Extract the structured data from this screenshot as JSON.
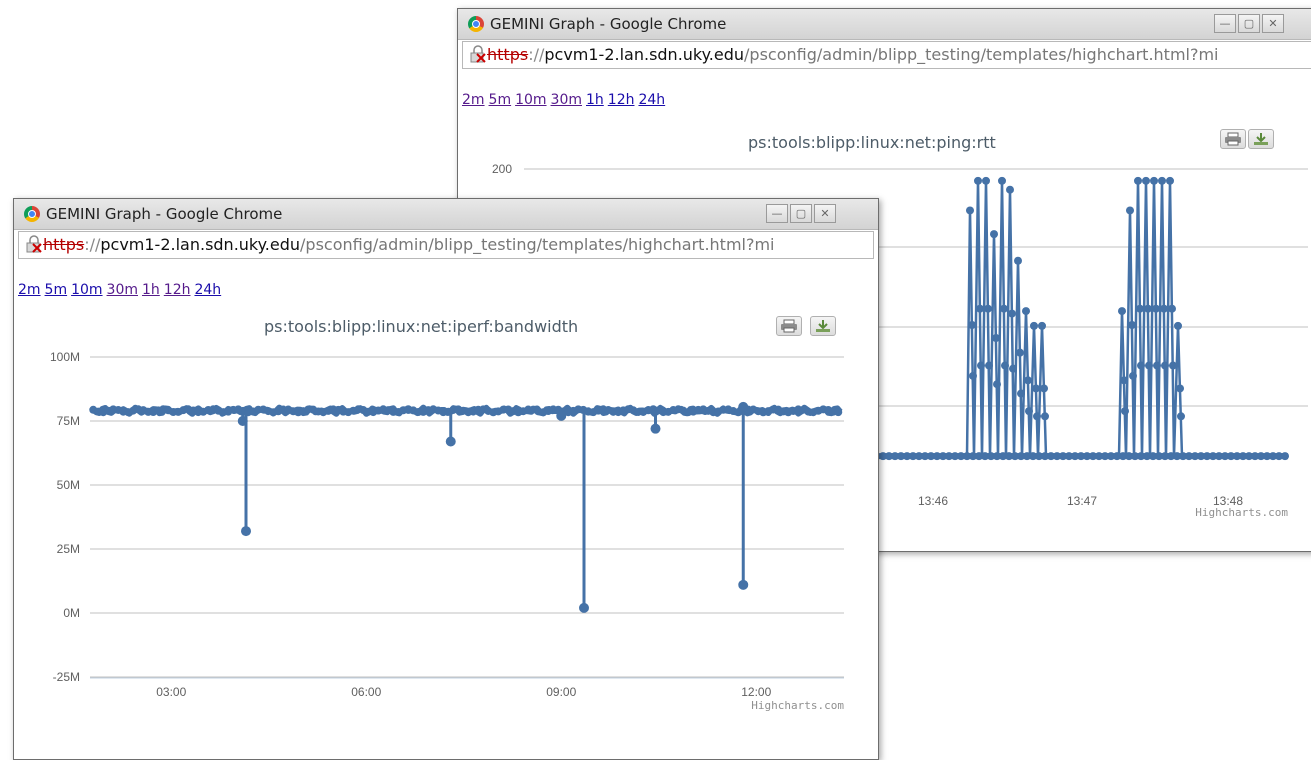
{
  "back_window": {
    "title": "GEMINI Graph - Google Chrome",
    "url": {
      "scheme": "https",
      "sep": "://",
      "host": "pcvm1-2.lan.sdn.uky.edu",
      "path": "/psconfig/admin/blipp_testing/templates/highchart.html?mi"
    },
    "ranges": [
      "2m",
      "5m",
      "10m",
      "30m",
      "1h",
      "12h",
      "24h"
    ],
    "chart_title": "ps:tools:blipp:linux:net:ping:rtt",
    "y_tick_visible": "200",
    "x_ticks": [
      "13:46",
      "13:47",
      "13:48"
    ],
    "credits": "Highcharts.com"
  },
  "front_window": {
    "title": "GEMINI Graph - Google Chrome",
    "url": {
      "scheme": "https",
      "sep": "://",
      "host": "pcvm1-2.lan.sdn.uky.edu",
      "path": "/psconfig/admin/blipp_testing/templates/highchart.html?mi"
    },
    "ranges": [
      "2m",
      "5m",
      "10m",
      "30m",
      "1h",
      "12h",
      "24h"
    ],
    "chart_title": "ps:tools:blipp:linux:net:iperf:bandwidth",
    "credits": "Highcharts.com"
  },
  "colors": {
    "series": "#4572a7",
    "grid": "#c0c0c0",
    "title": "#4d5c68"
  },
  "chart_data": [
    {
      "type": "line",
      "title": "ps:tools:blipp:linux:net:iperf:bandwidth",
      "y_ticks": [
        "100M",
        "75M",
        "50M",
        "25M",
        "0M",
        "-25M"
      ],
      "ylim": [
        -25,
        100
      ],
      "x_ticks": [
        "03:00",
        "06:00",
        "09:00",
        "12:00"
      ],
      "x_range_hours": [
        1.75,
        13.35
      ],
      "baseline": 79,
      "dips": [
        {
          "x": 4.1,
          "y": 75
        },
        {
          "x": 4.15,
          "y": 32
        },
        {
          "x": 7.3,
          "y": 67
        },
        {
          "x": 9.0,
          "y": 77
        },
        {
          "x": 9.35,
          "y": 2
        },
        {
          "x": 10.45,
          "y": 72
        },
        {
          "x": 11.8,
          "y": 11
        }
      ]
    },
    {
      "type": "line",
      "title": "ps:tools:blipp:linux:net:ping:rtt",
      "y_ticks": [
        "200"
      ],
      "x_ticks": [
        "13:46",
        "13:47",
        "13:48"
      ],
      "baseline_level": 0.03,
      "bursts": [
        {
          "x": [
            0.46,
            0.52,
            0.58,
            0.63,
            0.69,
            0.74,
            0.79,
            0.85,
            0.9,
            0.96
          ],
          "peaks": [
            0.86,
            0.96,
            0.96,
            0.78,
            0.96,
            0.93,
            0.69,
            0.52,
            0.47,
            0.47
          ]
        },
        {
          "x": [
            0.8,
            0.84,
            0.88,
            0.92,
            0.96,
            1.0,
            1.04,
            1.08
          ],
          "peaks": [
            0.52,
            0.86,
            0.96,
            0.96,
            0.96,
            0.96,
            0.96,
            0.47
          ]
        }
      ]
    }
  ]
}
